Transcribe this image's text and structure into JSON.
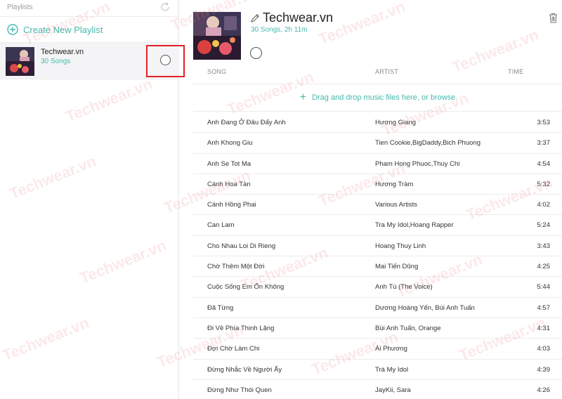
{
  "sidebar": {
    "title": "Playlists",
    "create_label": "Create New Playlist",
    "playlists": [
      {
        "name": "Techwear.vn",
        "count": "30 Songs"
      }
    ]
  },
  "playlist": {
    "title": "Techwear.vn",
    "subtitle": "30 Songs, 2h 11m"
  },
  "columns": {
    "song": "SONG",
    "artist": "ARTIST",
    "time": "TIME"
  },
  "drop_zone": {
    "label": "Drag and drop music files here, or browse"
  },
  "tracks": [
    {
      "song": "Anh Đang Ở Đâu Đấy Anh",
      "artist": "Hương Giang",
      "time": "3:53"
    },
    {
      "song": "Anh Khong Giu",
      "artist": "Tien Cookie,BigDaddy,Bich Phuong",
      "time": "3:37"
    },
    {
      "song": "Anh Se Tot Ma",
      "artist": "Pham Hong Phuoc,Thuy Chi",
      "time": "4:54"
    },
    {
      "song": "Cánh Hoa Tàn",
      "artist": "Hương Tràm",
      "time": "5:32"
    },
    {
      "song": "Cánh Hồng Phai",
      "artist": "Various Artists",
      "time": "4:02"
    },
    {
      "song": "Can Lam",
      "artist": "Tra My Idol,Hoang Rapper",
      "time": "5:24"
    },
    {
      "song": "Cho Nhau Loi Di Rieng",
      "artist": "Hoang Thuy Linh",
      "time": "3:43"
    },
    {
      "song": "Chờ Thêm Một Đời",
      "artist": "Mai Tiến Dũng",
      "time": "4:25"
    },
    {
      "song": "Cuộc Sống Em Ổn Không",
      "artist": "Anh Tú (The Voice)",
      "time": "5:44"
    },
    {
      "song": "Đã Từng",
      "artist": "Dương Hoàng Yến, Bùi Anh Tuấn",
      "time": "4:57"
    },
    {
      "song": "Đi Về Phía Thinh Lặng",
      "artist": "Bùi Anh Tuấn, Orange",
      "time": "4:31"
    },
    {
      "song": "Đợi Chờ Làm Chi",
      "artist": "Ái Phương",
      "time": "4:03"
    },
    {
      "song": "Đừng Nhắc Về Người Ấy",
      "artist": "Trà My Idol",
      "time": "4:39"
    },
    {
      "song": "Đừng Như Thói Quen",
      "artist": "JayKii, Sara",
      "time": "4:26"
    }
  ],
  "watermark": "Techwear.vn",
  "colors": {
    "accent": "#45b8ad",
    "highlight": "#e31f26"
  },
  "icons": [
    "refresh-icon",
    "plus-circle-icon",
    "pencil-icon",
    "trash-icon"
  ]
}
